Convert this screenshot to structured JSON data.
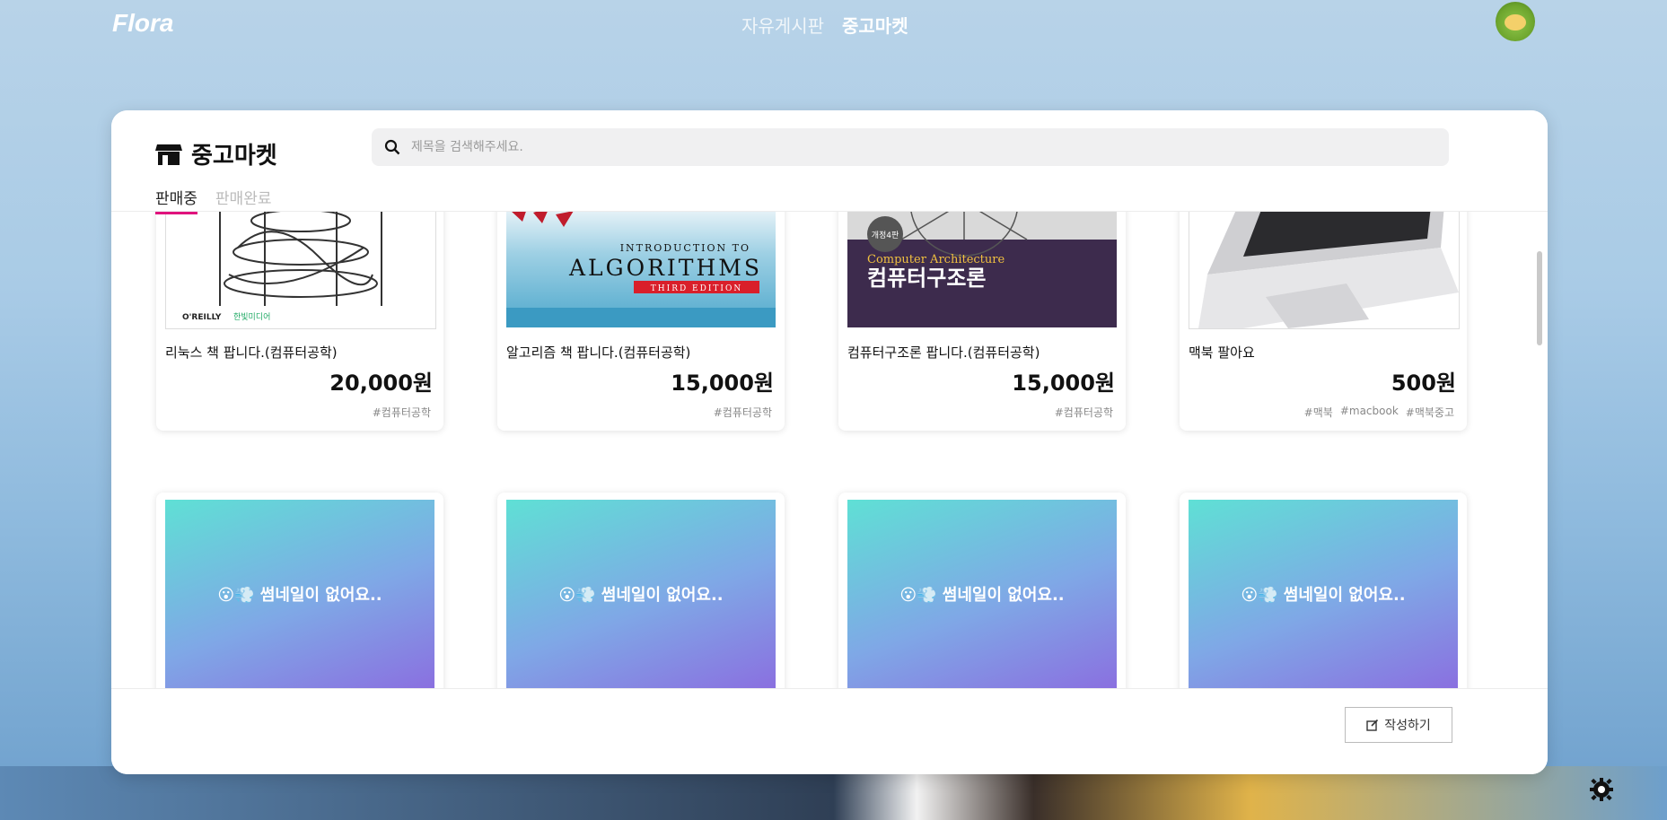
{
  "brand": {
    "logo": "Flora"
  },
  "nav": {
    "items": [
      {
        "label": "자유게시판",
        "active": false
      },
      {
        "label": "중고마켓",
        "active": true
      }
    ]
  },
  "avatar": {
    "icon": "avatar-character-icon"
  },
  "market": {
    "title": "중고마켓",
    "search_placeholder": "제목을 검색해주세요.",
    "tabs": [
      {
        "label": "판매중",
        "active": true
      },
      {
        "label": "판매완료",
        "active": false
      }
    ],
    "items": [
      {
        "title": "리눅스 책 팝니다.(컴퓨터공학)",
        "price": "20,000원",
        "tags": [
          "컴퓨터공학"
        ],
        "cover": {
          "publisher_left": "O'REILLY",
          "publisher_right": "한빛미디어"
        }
      },
      {
        "title": "알고리즘 책 팝니다.(컴퓨터공학)",
        "price": "15,000원",
        "tags": [
          "컴퓨터공학"
        ],
        "cover": {
          "line1": "INTRODUCTION TO",
          "line2": "ALGORITHMS",
          "edition": "THIRD EDITION"
        }
      },
      {
        "title": "컴퓨터구조론 팝니다.(컴퓨터공학)",
        "price": "15,000원",
        "tags": [
          "컴퓨터공학"
        ],
        "cover": {
          "badge": "개정4판",
          "en": "Computer Architecture",
          "ko": "컴퓨터구조론"
        }
      },
      {
        "title": "맥북 팔아요",
        "price": "500원",
        "tags": [
          "맥북",
          "macbook",
          "맥북중고"
        ]
      }
    ],
    "no_thumb_text": "😮💨 썸네일이 없어요..",
    "write_label": "작성하기"
  },
  "colors": {
    "accent": "#e0127d",
    "panel": "#ffffff"
  }
}
